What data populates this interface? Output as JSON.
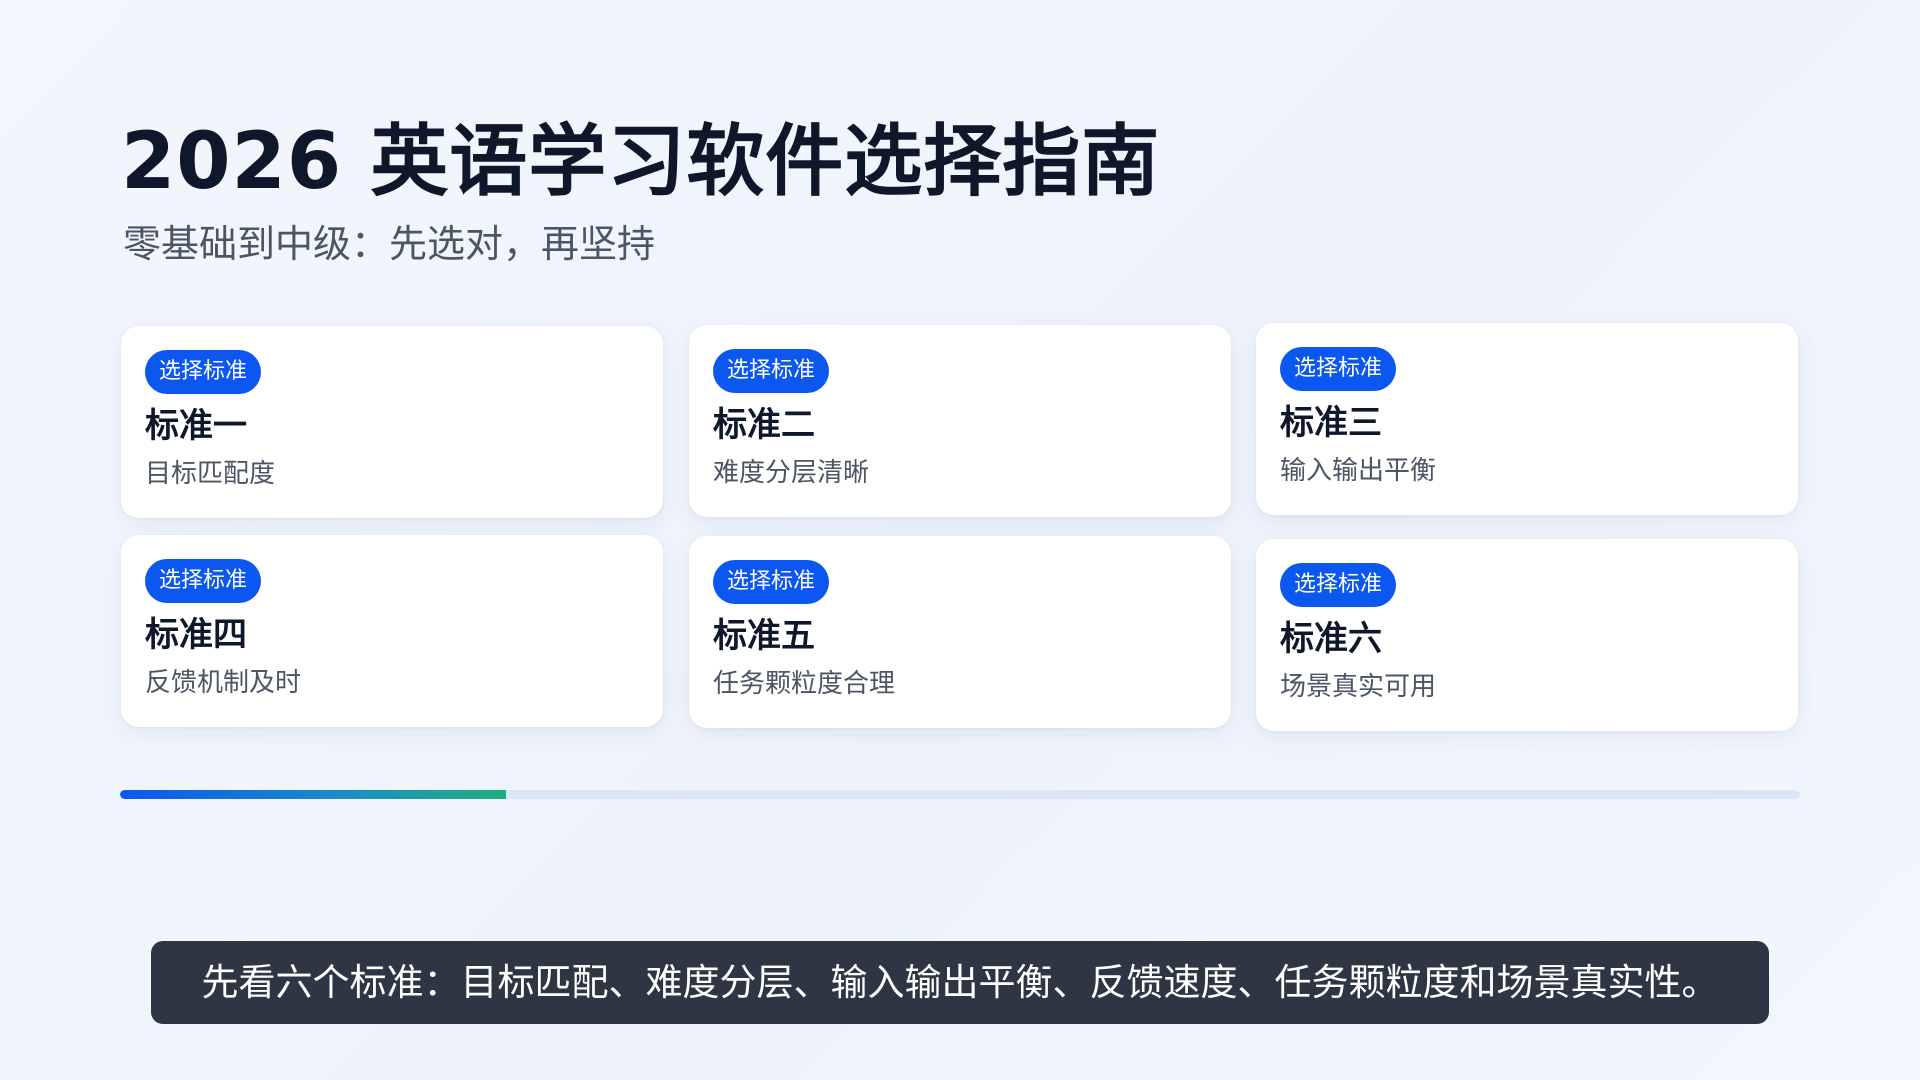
{
  "title": "2026 英语学习软件选择指南",
  "subtitle": "零基础到中级：先选对，再坚持",
  "cards": [
    {
      "badge": "选择标准",
      "title": "标准一",
      "desc": "目标匹配度"
    },
    {
      "badge": "选择标准",
      "title": "标准二",
      "desc": "难度分层清晰"
    },
    {
      "badge": "选择标准",
      "title": "标准三",
      "desc": "输入输出平衡"
    },
    {
      "badge": "选择标准",
      "title": "标准四",
      "desc": "反馈机制及时"
    },
    {
      "badge": "选择标准",
      "title": "标准五",
      "desc": "任务颗粒度合理"
    },
    {
      "badge": "选择标准",
      "title": "标准六",
      "desc": "场景真实可用"
    }
  ],
  "progress": {
    "fraction": 0.23
  },
  "caption": "先看六个标准：目标匹配、难度分层、输入输出平衡、反馈速度、任务颗粒度和场景真实性。",
  "colors": {
    "accent": "#0b57f0",
    "progress_end": "#1fae7e",
    "caption_bg": "#2f3643"
  }
}
